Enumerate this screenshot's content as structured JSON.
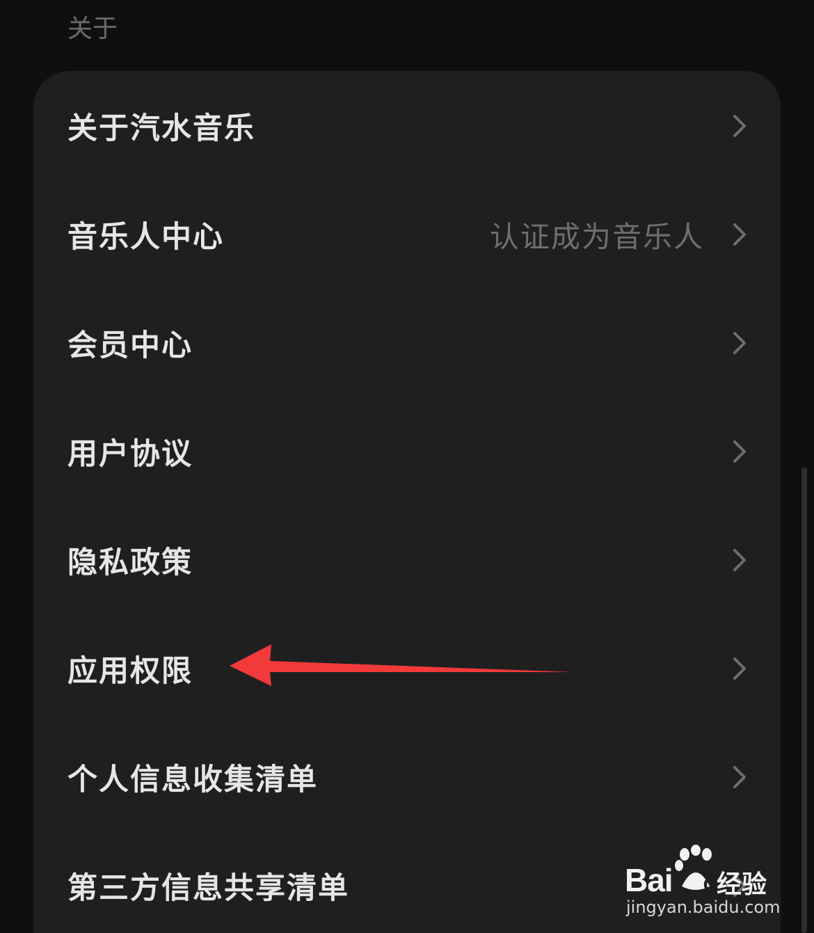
{
  "section": {
    "title": "关于"
  },
  "menu": {
    "items": [
      {
        "label": "关于汽水音乐",
        "subtitle": ""
      },
      {
        "label": "音乐人中心",
        "subtitle": "认证成为音乐人"
      },
      {
        "label": "会员中心",
        "subtitle": ""
      },
      {
        "label": "用户协议",
        "subtitle": ""
      },
      {
        "label": "隐私政策",
        "subtitle": ""
      },
      {
        "label": "应用权限",
        "subtitle": ""
      },
      {
        "label": "个人信息收集清单",
        "subtitle": ""
      },
      {
        "label": "第三方信息共享清单",
        "subtitle": ""
      }
    ],
    "chevron_icon": "chevron-right-icon"
  },
  "annotation": {
    "arrow_color": "#f23a3a",
    "points_to": "应用权限"
  },
  "watermark": {
    "brand": "Bai",
    "brand_suffix": "du",
    "product": "经验",
    "url": "jingyan.baidu.com"
  },
  "colors": {
    "background": "#0f0f0f",
    "card": "#1f1f1f",
    "text_primary": "#e6e6e6",
    "text_secondary": "#6e6e6e"
  }
}
